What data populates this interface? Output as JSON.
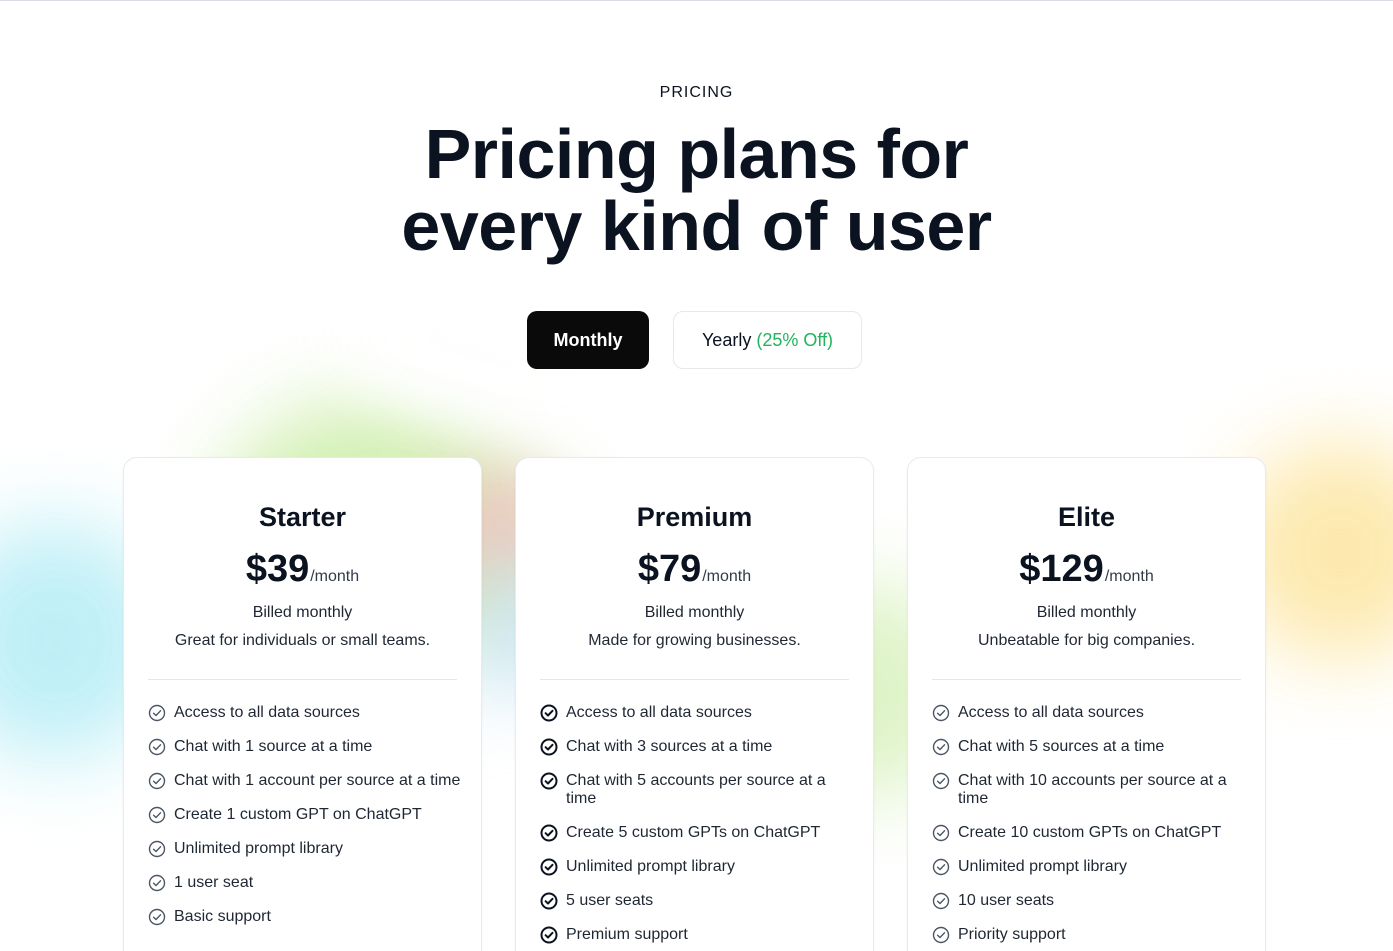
{
  "header": {
    "eyebrow": "PRICING",
    "title_line1": "Pricing plans for",
    "title_line2": "every kind of user"
  },
  "billing_toggle": {
    "monthly_label": "Monthly",
    "yearly_label": "Yearly",
    "yearly_discount": "(25% Off)",
    "selected": "Monthly"
  },
  "colors": {
    "accent_dark": "#0a0a0a",
    "discount_green": "#22b35e"
  },
  "plans": [
    {
      "name": "Starter",
      "price": "$39",
      "period": "/month",
      "billed": "Billed monthly",
      "tagline": "Great for individuals or small teams.",
      "check_style": "outline",
      "features": [
        "Access to all data sources",
        "Chat with 1 source at a time",
        "Chat with 1 account per source at a time",
        "Create 1 custom GPT on ChatGPT",
        "Unlimited prompt library",
        "1 user seat",
        "Basic support"
      ]
    },
    {
      "name": "Premium",
      "price": "$79",
      "period": "/month",
      "billed": "Billed monthly",
      "tagline": "Made for growing businesses.",
      "check_style": "bold",
      "features": [
        "Access to all data sources",
        "Chat with 3 sources at a time",
        "Chat with 5 accounts per source at a time",
        "Create 5 custom GPTs on ChatGPT",
        "Unlimited prompt library",
        "5 user seats",
        "Premium support"
      ]
    },
    {
      "name": "Elite",
      "price": "$129",
      "period": "/month",
      "billed": "Billed monthly",
      "tagline": "Unbeatable for big companies.",
      "check_style": "outline",
      "features": [
        "Access to all data sources",
        "Chat with 5 sources at a time",
        "Chat with 10 accounts per source at a time",
        "Create 10 custom GPTs on ChatGPT",
        "Unlimited prompt library",
        "10 user seats",
        "Priority support"
      ]
    }
  ]
}
